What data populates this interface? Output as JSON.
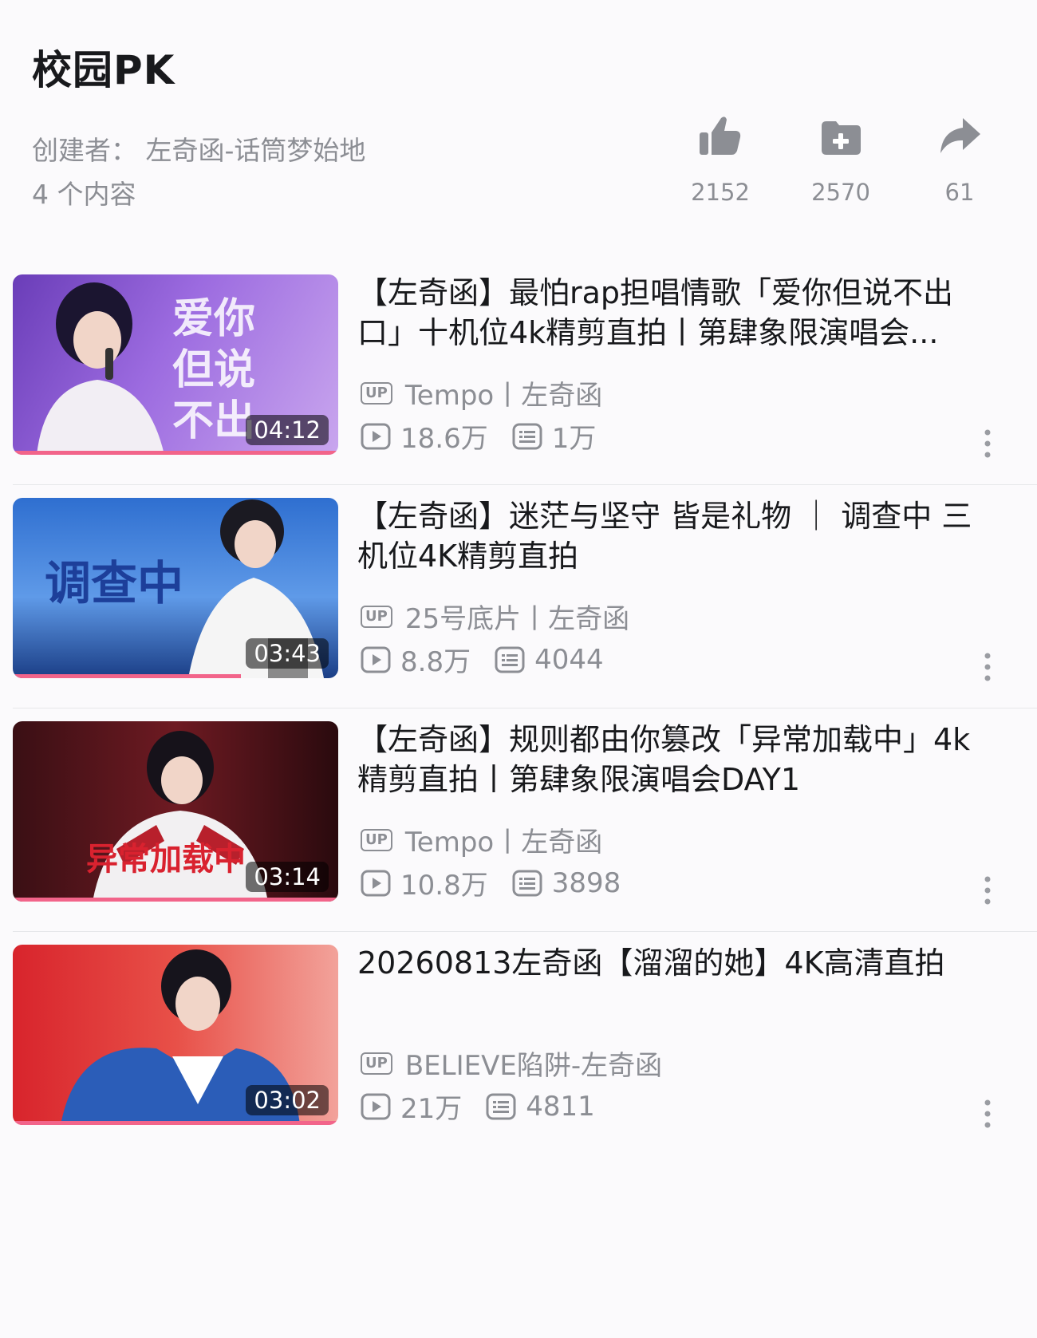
{
  "header": {
    "title": "校园PK",
    "creator": "创建者：  左奇函-话筒梦始地",
    "content_count": "4 个内容",
    "actions": [
      {
        "icon": "thumbs-up-icon",
        "count": "2152"
      },
      {
        "icon": "add-favorite-icon",
        "count": "2570"
      },
      {
        "icon": "share-icon",
        "count": "61"
      }
    ]
  },
  "videos": [
    {
      "title": "【左奇函】最怕rap担唱情歌「爱你但说不出口」十机位4k精剪直拍丨第肆象限演唱会...",
      "duration": "04:12",
      "uploader": "Tempo丨左奇函",
      "views": "18.6万",
      "danmaku": "1万",
      "thumb_text": "爱你但说不出口"
    },
    {
      "title": "【左奇函】迷茫与坚守 皆是礼物 ｜ 调查中 三机位4K精剪直拍",
      "duration": "03:43",
      "uploader": "25号底片丨左奇函",
      "views": "8.8万",
      "danmaku": "4044",
      "thumb_text": "调查中"
    },
    {
      "title": "【左奇函】规则都由你篡改「异常加载中」4k精剪直拍丨第肆象限演唱会DAY1",
      "duration": "03:14",
      "uploader": "Tempo丨左奇函",
      "views": "10.8万",
      "danmaku": "3898",
      "thumb_text": "异常加载中"
    },
    {
      "title": "20260813左奇函【溜溜的她】4K高清直拍",
      "duration": "03:02",
      "uploader": "BELIEVE陷阱-左奇函",
      "views": "21万",
      "danmaku": "4811",
      "thumb_text": ""
    }
  ],
  "colors": {
    "progress_bar": "#f2648a",
    "muted_text": "#8c8e94",
    "title_text": "#18191c"
  }
}
